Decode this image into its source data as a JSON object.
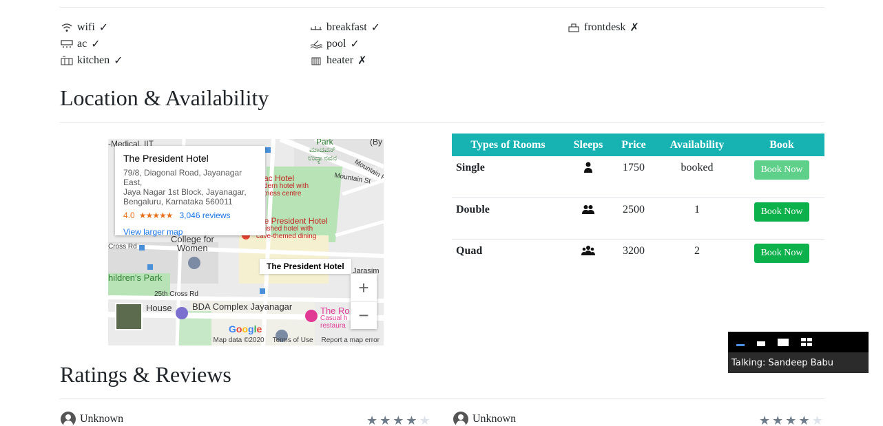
{
  "amenities": [
    {
      "name": "wifi",
      "mark": "✓",
      "icon": "wifi-icon"
    },
    {
      "name": "ac",
      "mark": "✓",
      "icon": "ac-icon"
    },
    {
      "name": "kitchen",
      "mark": "✓",
      "icon": "kitchen-icon"
    },
    {
      "name": "breakfast",
      "mark": "✓",
      "icon": "breakfast-icon"
    },
    {
      "name": "pool",
      "mark": "✓",
      "icon": "pool-icon"
    },
    {
      "name": "heater",
      "mark": "✗",
      "icon": "heater-icon"
    },
    {
      "name": "frontdesk",
      "mark": "✗",
      "icon": "frontdesk-icon"
    }
  ],
  "location_title": "Location & Availability",
  "map": {
    "card_title": "The President Hotel",
    "address_1": "79/8, Diagonal Road, Jayanagar East,",
    "address_2": "Jaya Nagar 1st Block, Jayanagar,",
    "address_3": "Bengaluru, Karnataka 560011",
    "rating": "4.0",
    "stars": "★★★★★",
    "reviews": "3,046 reviews",
    "view_larger": "View larger map",
    "pin_label": "The President Hotel",
    "labels": {
      "medical": "-Medical, IIT",
      "park": "Park",
      "kannada_1": "ಮಾದವನ್",
      "kannada_2": "ಉದ್ಯಾನವನ",
      "mountain_1": "Mountain R",
      "mountain_2": "Mountain St",
      "hotel_red_1": "ac Hotel",
      "hotel_red_2": "dern hotel with",
      "hotel_red_3": "tness centre",
      "president_red": "he President Hotel",
      "president_sub_1": "lished hotel with",
      "president_sub_2": "cave-themed dining",
      "college_1": "College for",
      "college_2": "Women",
      "cross_rd": "Cross Rd",
      "children_park": "hildren's Park",
      "cross25": "25th Cross Rd",
      "house": "House",
      "bda": "BDA Complex Jayanagar",
      "the_ro": "The Ro",
      "casual": "Casual h",
      "restaura": "restaura",
      "jarasim": "Jarasim",
      "by": "(By"
    },
    "google": "Google",
    "footer": [
      "Map data ©2020",
      "Terms of Use",
      "Report a map error"
    ]
  },
  "rooms": {
    "headers": [
      "Types of Rooms",
      "Sleeps",
      "Price",
      "Availability",
      "Book"
    ],
    "rows": [
      {
        "type": "Single",
        "sleeps_icon": "person-icon",
        "price": "1750",
        "availability": "booked",
        "book": "Book Now",
        "disabled": true
      },
      {
        "type": "Double",
        "sleeps_icon": "two-persons-icon",
        "price": "2500",
        "availability": "1",
        "book": "Book Now",
        "disabled": false
      },
      {
        "type": "Quad",
        "sleeps_icon": "group-icon",
        "price": "3200",
        "availability": "2",
        "book": "Book Now",
        "disabled": false
      }
    ]
  },
  "talking": {
    "label": "Talking: Sandeep Babu"
  },
  "ratings_title": "Ratings & Reviews",
  "reviews": [
    {
      "user": "Unknown",
      "stars": 4
    },
    {
      "user": "Unknown",
      "stars": 4
    }
  ]
}
